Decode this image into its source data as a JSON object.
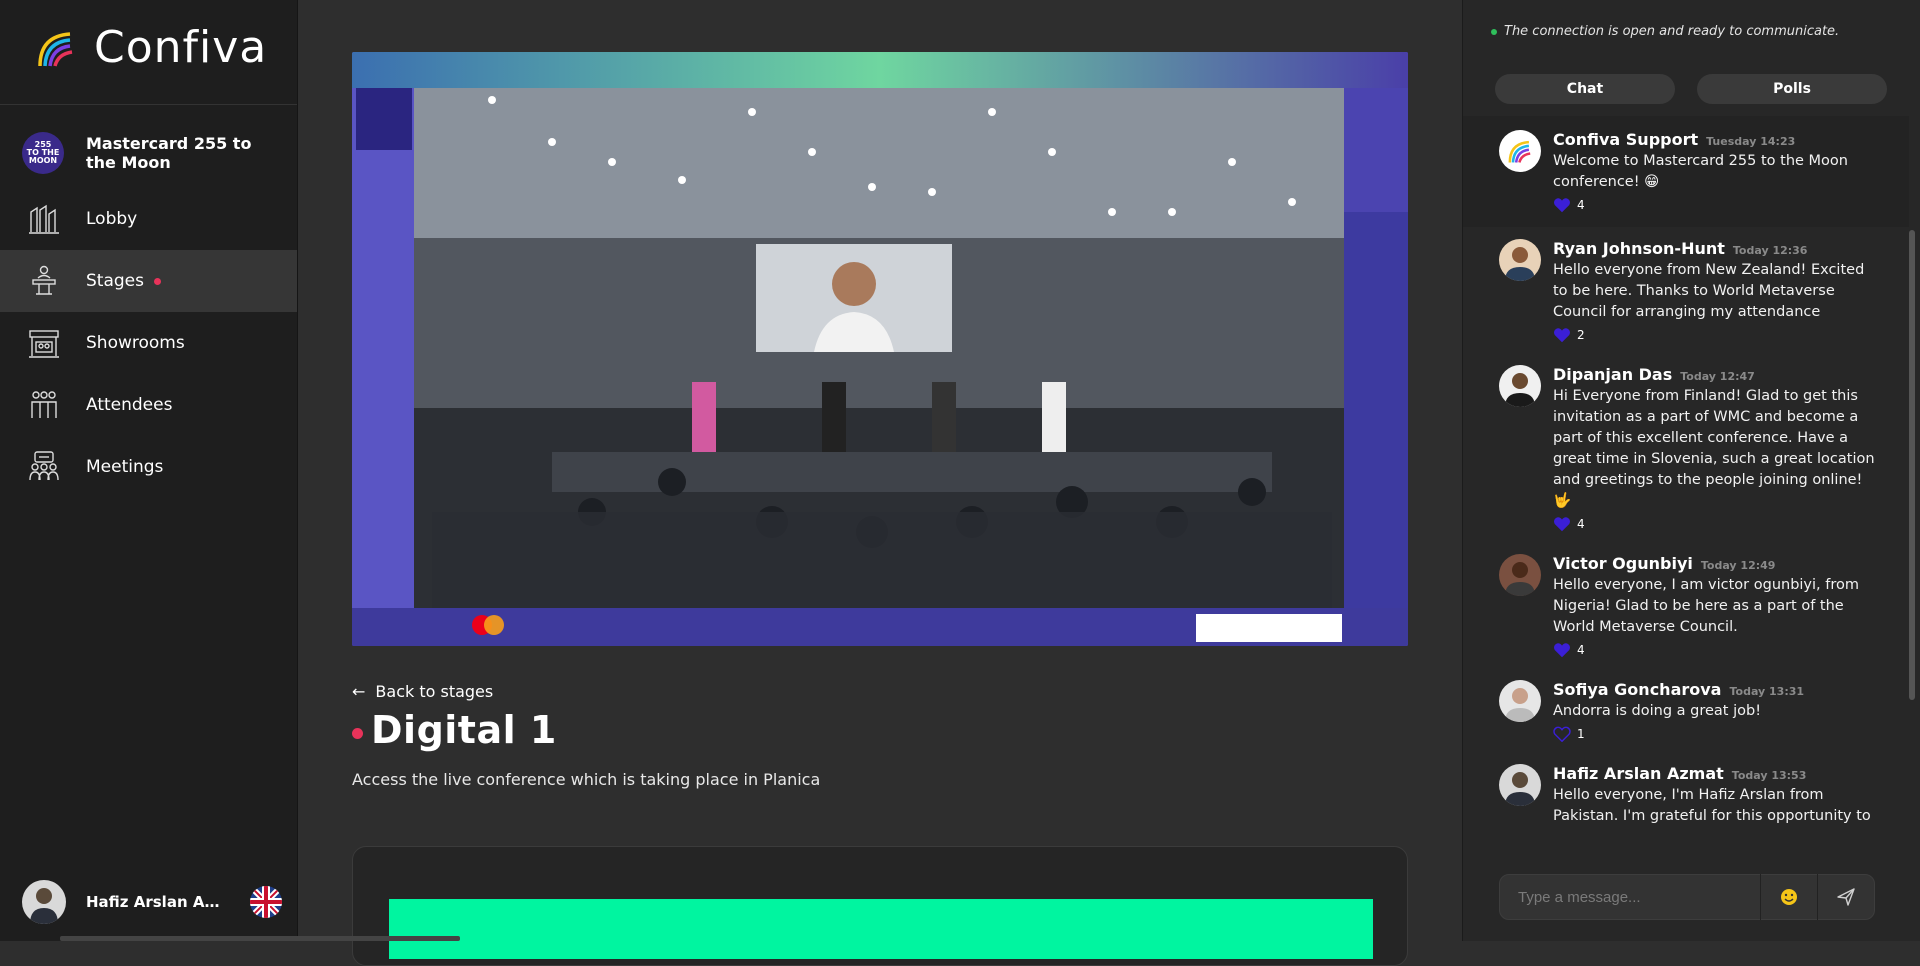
{
  "app": {
    "name": "Confiva"
  },
  "event": {
    "name": "Mastercard 255 to the Moon",
    "badge_lines": [
      "255",
      "TO THE",
      "MOON"
    ]
  },
  "nav": [
    {
      "label": "Lobby",
      "icon": "lobby-icon",
      "active": false
    },
    {
      "label": "Stages",
      "icon": "stage-podium-icon",
      "active": true,
      "live": true
    },
    {
      "label": "Showrooms",
      "icon": "showroom-icon",
      "active": false
    },
    {
      "label": "Attendees",
      "icon": "attendees-icon",
      "active": false
    },
    {
      "label": "Meetings",
      "icon": "meetings-icon",
      "active": false
    }
  ],
  "user": {
    "name": "Hafiz Arslan Azmat",
    "display_name": "Hafiz Arslan Az...",
    "language": "uk-flag-icon"
  },
  "stage": {
    "back_label": "Back to stages",
    "title": "Digital 1",
    "description": "Access the live conference which is taking place in Planica"
  },
  "chat": {
    "connection_status": "The connection is open and ready to communicate.",
    "tabs": {
      "chat": "Chat",
      "polls": "Polls"
    },
    "placeholder": "Type a message...",
    "messages": [
      {
        "author": "Confiva Support",
        "time": "Tuesday 14:23",
        "text": "Welcome to Mastercard 255 to the Moon conference! 😁",
        "likes": "4",
        "liked": true
      },
      {
        "author": "Ryan Johnson-Hunt",
        "time": "Today 12:36",
        "text": "Hello everyone from New Zealand! Excited to be here. Thanks to World Metaverse Council for arranging my attendance",
        "likes": "2",
        "liked": true
      },
      {
        "author": "Dipanjan Das",
        "time": "Today 12:47",
        "text": "Hi Everyone from Finland! Glad to get this invitation as a part of WMC and become a part of this excellent conference. Have a great time in Slovenia, such a great location and greetings to the people joining online! 🤟",
        "likes": "4",
        "liked": true
      },
      {
        "author": "Victor Ogunbiyi",
        "time": "Today 12:49",
        "text": "Hello everyone, I am victor ogunbiyi, from Nigeria! Glad to be here as a part of the World Metaverse Council.",
        "likes": "4",
        "liked": true
      },
      {
        "author": "Sofiya Goncharova",
        "time": "Today 13:31",
        "text": "Andorra is doing a great job!",
        "likes": "1",
        "liked": false
      },
      {
        "author": "Hafiz Arslan Azmat",
        "time": "Today 13:53",
        "text": "Hello everyone, I'm Hafiz Arslan from Pakistan. I'm grateful for this opportunity to",
        "likes": "",
        "liked": false
      }
    ]
  },
  "colors": {
    "accent_live": "#e8335a",
    "like": "#3b1fd6",
    "banner": "#00f5a0",
    "online": "#2fbf5b"
  }
}
